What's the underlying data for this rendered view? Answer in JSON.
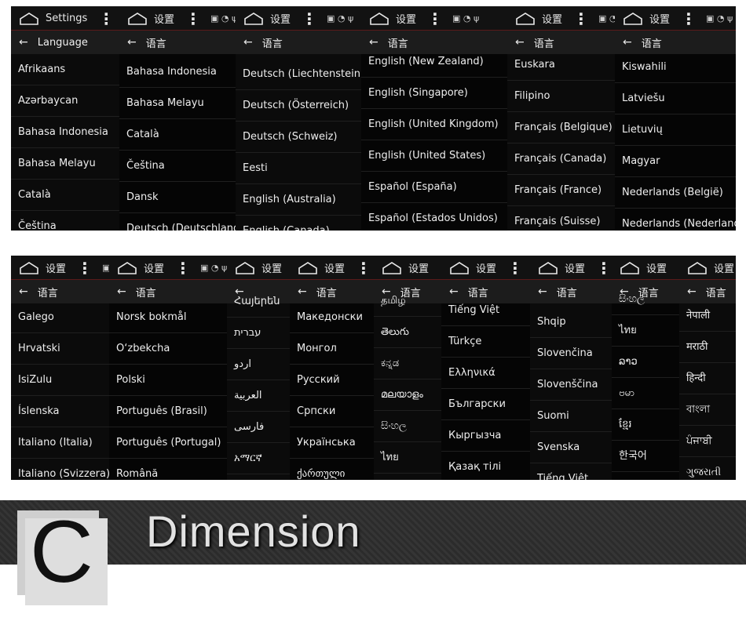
{
  "status_icons": "▣ ◔ ψ",
  "row1": [
    {
      "status_title": "Settings",
      "action_title": "Language",
      "items": [
        "Afrikaans",
        "Azərbaycan",
        "Bahasa Indonesia",
        "Bahasa Melayu",
        "Català",
        "Čeština"
      ]
    },
    {
      "status_title": "设置",
      "action_title": "语言",
      "items": [
        "Bahasa Indonesia",
        "Bahasa Melayu",
        "Català",
        "Čeština",
        "Dansk",
        "Deutsch (Deutschland)"
      ]
    },
    {
      "status_title": "设置",
      "action_title": "语言",
      "items": [
        "Deutsch (Liechtenstein)",
        "Deutsch (Österreich)",
        "Deutsch (Schweiz)",
        "Eesti",
        "English (Australia)",
        "English (Canada)"
      ]
    },
    {
      "status_title": "设置",
      "action_title": "语言",
      "items": [
        "English (New Zealand)",
        "English (Singapore)",
        "English (United Kingdom)",
        "English (United States)",
        "Español (España)",
        "Español (Estados Unidos)"
      ]
    },
    {
      "status_title": "设置",
      "action_title": "语言",
      "items": [
        "Euskara",
        "Filipino",
        "Français (Belgique)",
        "Français (Canada)",
        "Français (France)",
        "Français (Suisse)"
      ]
    },
    {
      "status_title": "设置",
      "action_title": "语言",
      "items": [
        "Kiswahili",
        "Latviešu",
        "Lietuvių",
        "Magyar",
        "Nederlands (België)",
        "Nederlands (Nederland)"
      ]
    }
  ],
  "row2": [
    {
      "status_title": "设置",
      "action_title": "语言",
      "items": [
        "Galego",
        "Hrvatski",
        "IsiZulu",
        "Íslenska",
        "Italiano (Italia)",
        "Italiano (Svizzera)"
      ]
    },
    {
      "status_title": "设置",
      "action_title": "语言",
      "items": [
        "Norsk bokmål",
        "O‘zbekcha",
        "Polski",
        "Português (Brasil)",
        "Português (Portugal)",
        "Română"
      ]
    },
    {
      "status_title": "设置",
      "action_title": "",
      "items": [
        "Հայերեն",
        "עברית",
        "اردو",
        "العربية",
        "فارسی",
        "አማርኛ"
      ]
    },
    {
      "status_title": "设置",
      "action_title": "语言",
      "items": [
        "Македонски",
        "Монгол",
        "Русский",
        "Српски",
        "Українська",
        "ქართული"
      ]
    },
    {
      "status_title": "设置",
      "action_title": "语言",
      "items": [
        "தமிழ்",
        "తెలుగు",
        "ಕನ್ನಡ",
        "മലയാളം",
        "සිංහල",
        "ไทย"
      ]
    },
    {
      "status_title": "设置",
      "action_title": "语言",
      "items": [
        "Tiếng Việt",
        "Türkçe",
        "Ελληνικά",
        "Български",
        "Кыргызча",
        "Қазақ тілі"
      ]
    },
    {
      "status_title": "设置",
      "action_title": "语言",
      "items": [
        "Shqip",
        "Slovenčina",
        "Slovenščina",
        "Suomi",
        "Svenska",
        "Tiếng Việt"
      ]
    },
    {
      "status_title": "设置",
      "action_title": "语言",
      "items": [
        "සිංහල",
        "ไทย",
        "ລາວ",
        "ဗမာ",
        "ខ្មែរ",
        "한국어"
      ]
    },
    {
      "status_title": "设置",
      "action_title": "语言",
      "items": [
        "नेपाली",
        "मराठी",
        "हिन्दी",
        "বাংলা",
        "ਪੰਜਾਬੀ",
        "ગુજરાતી"
      ]
    }
  ],
  "banner": {
    "letter": "C",
    "title": "Dimension"
  }
}
